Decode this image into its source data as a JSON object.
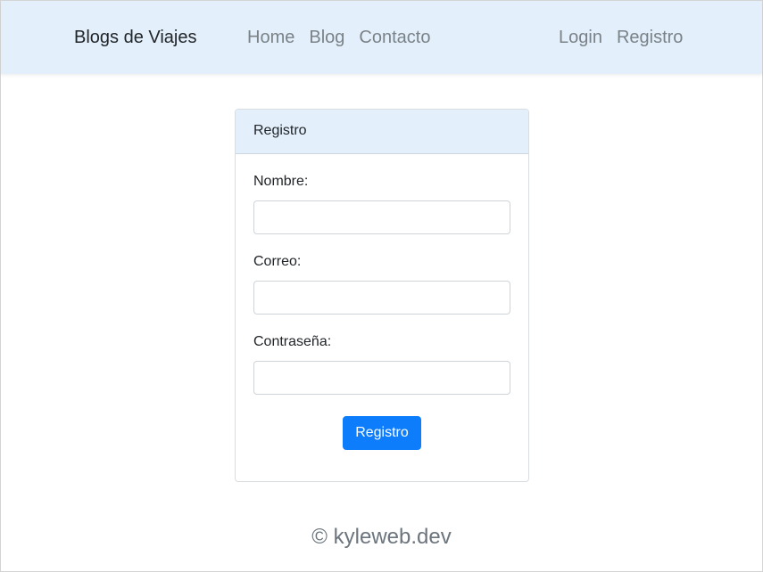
{
  "navbar": {
    "brand": "Blogs de Viajes",
    "links_left": [
      "Home",
      "Blog",
      "Contacto"
    ],
    "links_right": [
      "Login",
      "Registro"
    ]
  },
  "card": {
    "header": "Registro",
    "fields": [
      {
        "label": "Nombre:",
        "value": "",
        "placeholder": ""
      },
      {
        "label": "Correo:",
        "value": "",
        "placeholder": ""
      },
      {
        "label": "Contraseña:",
        "value": "",
        "placeholder": ""
      }
    ],
    "submit_label": "Registro"
  },
  "footer": {
    "text": "© kyleweb.dev"
  },
  "colors": {
    "navbar_bg": "#e3f0fb",
    "primary": "#0d7dfc",
    "nav_link": "#7a8288"
  }
}
